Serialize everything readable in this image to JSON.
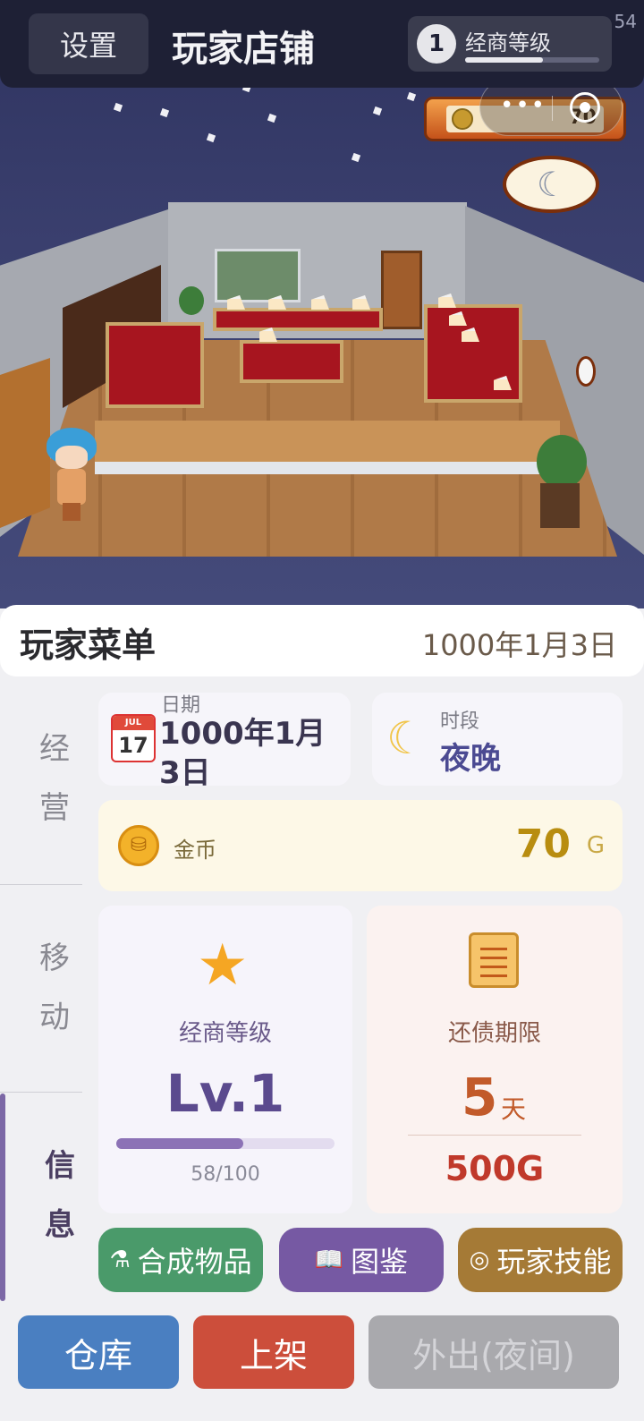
{
  "topbar": {
    "settings_label": "设置",
    "title": "玩家店铺",
    "level_number": "1",
    "level_label": "经商等级",
    "corner_text": "54"
  },
  "scene": {
    "capsule_dots": "•••",
    "gold_sign_value": "70",
    "time_icon": "moon-icon"
  },
  "menu": {
    "title": "玩家菜单",
    "header_date": "1000年1月3日"
  },
  "side_tabs": [
    {
      "label": "经营"
    },
    {
      "label": "移动"
    },
    {
      "label": "信息"
    }
  ],
  "info": {
    "date": {
      "label": "日期",
      "value": "1000年1月3日",
      "calendar_month": "JUL",
      "calendar_day": "17"
    },
    "period": {
      "label": "时段",
      "value": "夜晚",
      "icon": "moon-icon"
    },
    "gold": {
      "label": "金币",
      "value": "70",
      "unit": "G",
      "icon": "coin-icon"
    },
    "business_level": {
      "label": "经商等级",
      "value": "Lv.1",
      "progress_text": "58/100",
      "progress_fraction": 0.58
    },
    "debt": {
      "label": "还债期限",
      "days": "5",
      "days_unit": "天",
      "amount": "500G"
    }
  },
  "actions": {
    "craft": "合成物品",
    "book": "图鉴",
    "skill": "玩家技能"
  },
  "bottom": {
    "store": "仓库",
    "shelf": "上架",
    "out": "外出(夜间)"
  },
  "colors": {
    "accent_purple": "#7659a3",
    "gold": "#b88d10",
    "danger": "#c0392b",
    "store_blue": "#4a7fc1",
    "shelf_red": "#cc4e3b",
    "disabled_gray": "#a9a9ad"
  }
}
